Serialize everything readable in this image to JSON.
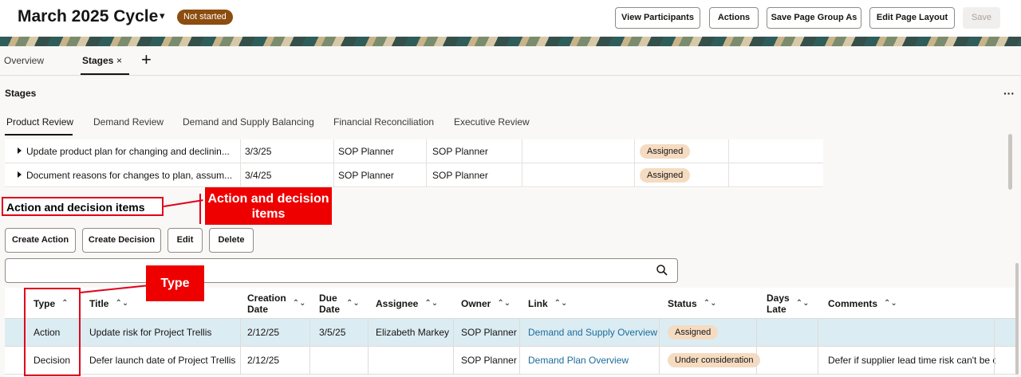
{
  "header": {
    "title": "March 2025 Cycle",
    "chevron": "▾",
    "status": "Not started",
    "buttons": [
      "View Participants",
      "Actions",
      "Save Page Group As",
      "Edit Page Layout",
      "Save"
    ]
  },
  "page_tabs": {
    "overview": "Overview",
    "stages": "Stages",
    "close_glyph": "×",
    "add_glyph": "+"
  },
  "section_title": "Stages",
  "more_glyph": "···",
  "stage_tabs": [
    "Product Review",
    "Demand Review",
    "Demand and Supply Balancing",
    "Financial Reconciliation",
    "Executive Review"
  ],
  "tasks": [
    {
      "task": "Update product plan for changing and declinin...",
      "date": "3/3/25",
      "assignee": "SOP Planner",
      "owner": "SOP Planner",
      "status": "Assigned"
    },
    {
      "task": "Document reasons for changes to plan, assum...",
      "date": "3/4/25",
      "assignee": "SOP Planner",
      "owner": "SOP Planner",
      "status": "Assigned"
    }
  ],
  "action_section": {
    "title": "Action and decision items",
    "callout": "Action and decision items",
    "buttons": [
      "Create Action",
      "Create Decision",
      "Edit",
      "Delete"
    ],
    "search_placeholder": ""
  },
  "type_callout": "Type",
  "items_table": {
    "headers": {
      "type": "Type",
      "title": "Title",
      "creation_date": "Creation Date",
      "due_date": "Due Date",
      "assignee": "Assignee",
      "owner": "Owner",
      "link": "Link",
      "status": "Status",
      "days_late": "Days Late",
      "comments": "Comments"
    },
    "sort_asc": "⌃",
    "sort_both": "⌃⌄",
    "rows": [
      {
        "type": "Action",
        "title": "Update risk for Project Trellis",
        "creation_date": "2/12/25",
        "due_date": "3/5/25",
        "assignee": "Elizabeth Markey",
        "owner": "SOP Planner",
        "link": "Demand and Supply Overview",
        "status": "Assigned",
        "days_late": "",
        "comments": ""
      },
      {
        "type": "Decision",
        "title": "Defer launch date of Project Trellis",
        "creation_date": "2/12/25",
        "due_date": "",
        "assignee": "",
        "owner": "SOP Planner",
        "link": "Demand Plan Overview",
        "status": "Under consideration",
        "days_late": "",
        "comments": "Defer if supplier lead time risk can't be c"
      }
    ]
  },
  "colors": {
    "status_not_started": "#8c4d0f",
    "chip": "#f5dbc1",
    "link": "#1c6c9c",
    "callout": "#ee0000",
    "selected_row": "#dcecf3"
  }
}
